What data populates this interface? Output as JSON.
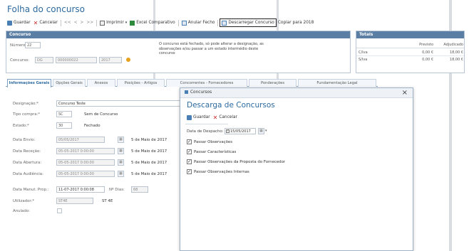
{
  "page": {
    "title": "Folha do concurso"
  },
  "toolbar": {
    "guardar": "Guardar",
    "cancelar": "Cancelar",
    "first": "<<",
    "prev": "<",
    "next": ">",
    "last": ">>",
    "imprimir": "Imprimir",
    "excel": "Excel Comparativo",
    "anular": "Anular Fecho",
    "descarregar": "Descarregar Concurso",
    "copiar": "Copiar para 2018"
  },
  "concurso": {
    "header": "Concurso",
    "numero_label": "Número:",
    "numero": "22",
    "concurso_label": "Concurso:",
    "serie": "DG",
    "codigo": "000000022",
    "ano": "2017",
    "notice": "O concurso está fechado, só pode alterar a designação, as observações e/ou passar a um estado intermédio deste concurso"
  },
  "totais": {
    "header": "Totais",
    "col_previsto": "Previsto",
    "col_adjudicado": "Adjudicado",
    "rows": [
      {
        "label": "C/Iva",
        "previsto": "0,00 €",
        "adjudicado": "18,00 €"
      },
      {
        "label": "S/Iva",
        "previsto": "0,00 €",
        "adjudicado": "18,00 €"
      }
    ]
  },
  "tabs": [
    "Informações Gerais",
    "Opções Gerais",
    "Anexos",
    "Posições - Artigos",
    "Concorrentes - Fornecedores",
    "Ponderações",
    "Fundamentação Legal"
  ],
  "form": {
    "designacao_label": "Designação:*",
    "designacao": "Concurso Teste",
    "tipo_label": "Tipo compra:*",
    "tipo_code": "SC",
    "tipo_value": "Sem de Concurso",
    "estado_label": "Estado:*",
    "estado_code": "30",
    "estado_value": "Fechado",
    "envio_label": "Data Envio:",
    "envio_date": "05/05/2017",
    "envio_text": "5 de Maio de 2017",
    "rececao_label": "Data Receção:",
    "rececao_date": "05-05-2017 0:00:00",
    "rececao_text": "5 de Maio de 2017",
    "abertura_label": "Data Abertura:",
    "abertura_date": "05-05-2017 0:00:00",
    "abertura_text": "5 de Maio de 2017",
    "audiencia_label": "Data Audiência:",
    "audiencia_date": "05-05-2017 0:00:00",
    "audiencia_text": "5 de Maio de 2017",
    "manut_label": "Data Manut. Prop.:",
    "manut_date": "11-07-2017 0:00:08",
    "nr_dias_label": "Nº Dias:",
    "nr_dias": "68",
    "utilizador_label": "Utilizador:*",
    "utilizador_code": "ST4E",
    "utilizador_value": "ST 4E",
    "anulado_label": "Anulado:"
  },
  "modal": {
    "window_title": "Concursos",
    "heading": "Descarga de Concursos",
    "guardar": "Guardar",
    "cancelar": "Cancelar",
    "data_label": "Data de Despacho:",
    "data_value": "15/05/2017",
    "checks": [
      "Passar Observações",
      "Passar Características",
      "Passar Observações da Proposta do Fornecedor",
      "Passar Observações Internas"
    ]
  },
  "colors": {
    "accent": "#2d6a9f",
    "header": "#5b7fa4"
  }
}
